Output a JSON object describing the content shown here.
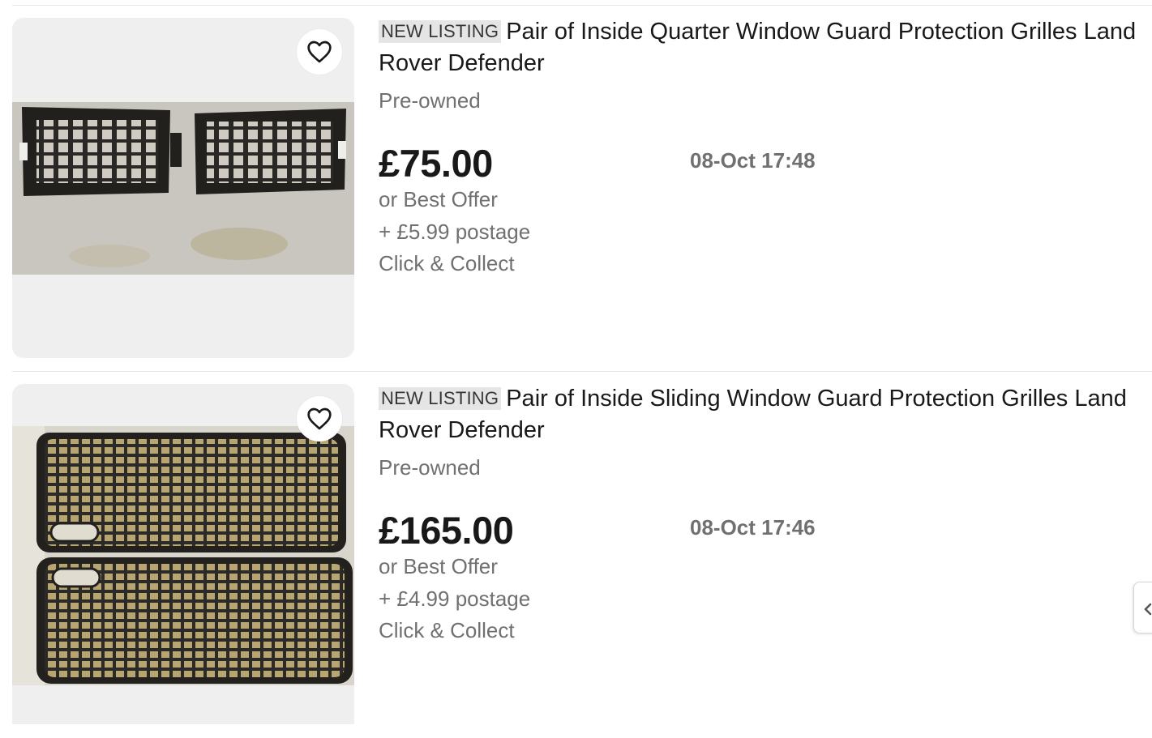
{
  "listings": [
    {
      "badge": "NEW LISTING",
      "title": "Pair of Inside Quarter Window Guard Protection Grilles Land Rover Defender",
      "condition": "Pre-owned",
      "price": "£75.00",
      "offer": "or Best Offer",
      "postage": "+ £5.99 postage",
      "collect": "Click & Collect",
      "time_listed": "08-Oct 17:48",
      "favorite_icon": "heart-outline-icon"
    },
    {
      "badge": "NEW LISTING",
      "title": "Pair of Inside Sliding Window Guard Protection Grilles Land Rover Defender",
      "condition": "Pre-owned",
      "price": "£165.00",
      "offer": "or Best Offer",
      "postage": "+ £4.99 postage",
      "collect": "Click & Collect",
      "time_listed": "08-Oct 17:46",
      "favorite_icon": "heart-outline-icon"
    }
  ],
  "colors": {
    "text_primary": "#191919",
    "text_secondary": "#707070",
    "badge_bg": "#e5e5e5",
    "image_bg": "#efefef"
  }
}
